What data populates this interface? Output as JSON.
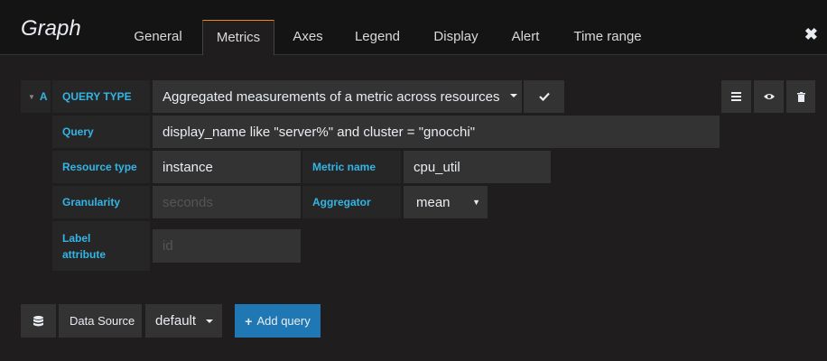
{
  "header": {
    "title": "Graph",
    "tabs": [
      {
        "label": "General"
      },
      {
        "label": "Metrics"
      },
      {
        "label": "Axes"
      },
      {
        "label": "Legend"
      },
      {
        "label": "Display"
      },
      {
        "label": "Alert"
      },
      {
        "label": "Time range"
      }
    ],
    "active_tab": "Metrics",
    "close_glyph": "✖"
  },
  "query": {
    "ref_id": "A",
    "query_type_label": "QUERY TYPE",
    "query_type_value": "Aggregated measurements of a metric across resources",
    "query_label": "Query",
    "query_value": "display_name like \"server%\" and cluster = \"gnocchi\"",
    "resource_type_label": "Resource type",
    "resource_type_value": "instance",
    "metric_name_label": "Metric name",
    "metric_name_value": "cpu_util",
    "granularity_label": "Granularity",
    "granularity_placeholder": "seconds",
    "aggregator_label": "Aggregator",
    "aggregator_value": "mean",
    "label_attribute_label_line1": "Label",
    "label_attribute_label_line2": "attribute",
    "label_attribute_placeholder": "id"
  },
  "footer": {
    "data_source_label": "Data Source",
    "data_source_value": "default",
    "add_query_label": "Add query"
  },
  "colors": {
    "accent": "#33b5e5",
    "active_tab_border": "#e88a1a",
    "primary_button": "#1f78b4"
  }
}
